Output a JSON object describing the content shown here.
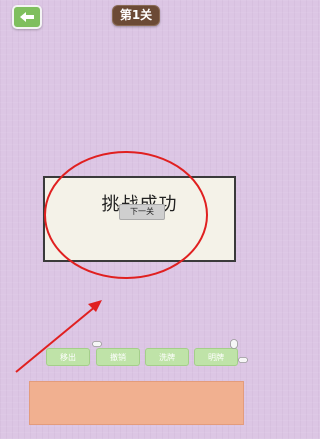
{
  "header": {
    "back_icon": "back-arrow-icon",
    "level_title": "第1关",
    "accent_color": "#7fbf5e",
    "title_color": "#6c4a36"
  },
  "dialog": {
    "message": "挑战成功",
    "next_button_label": "下一关"
  },
  "actions": {
    "items": [
      {
        "label": "移出",
        "badge_icon": "capsule-icon"
      },
      {
        "label": "撤销",
        "badge_icon": ""
      },
      {
        "label": "洗牌",
        "badge_icon": ""
      },
      {
        "label": "明牌",
        "badge_icon": "capsule-icon"
      }
    ],
    "button_color": "#bfe3a8"
  },
  "tray": {
    "color": "#f1b090"
  },
  "annotation": {
    "color": "#e02020",
    "shapes": [
      "ellipse-highlight",
      "arrow"
    ]
  }
}
